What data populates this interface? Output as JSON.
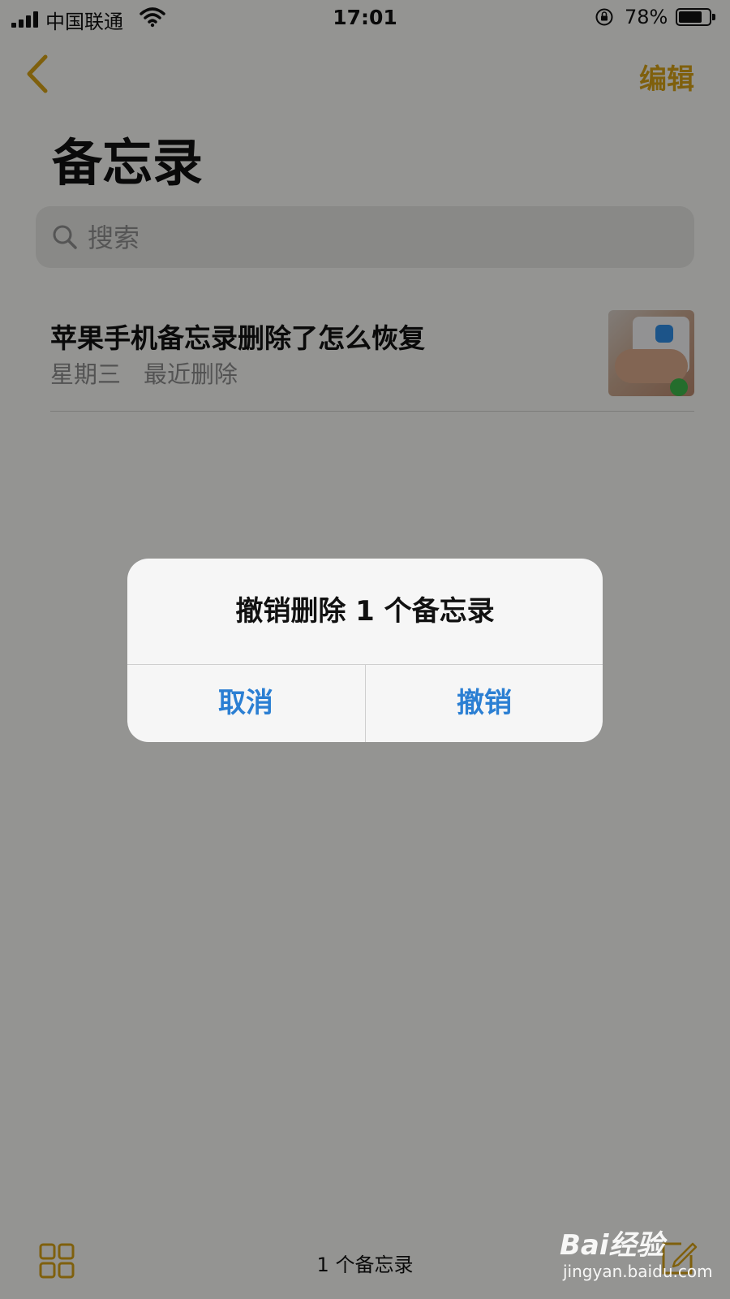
{
  "status_bar": {
    "carrier": "中国联通",
    "time": "17:01",
    "battery_percent_label": "78%",
    "battery_level": 0.78
  },
  "nav": {
    "edit_label": "编辑",
    "title": "备忘录"
  },
  "search": {
    "placeholder": "搜索"
  },
  "notes": [
    {
      "title": "苹果手机备忘录删除了怎么恢复",
      "day": "星期三",
      "folder": "最近删除"
    }
  ],
  "alert": {
    "title": "撤销删除 1 个备忘录",
    "cancel_label": "取消",
    "confirm_label": "撤销"
  },
  "toolbar": {
    "count_label": "1 个备忘录"
  },
  "watermark": {
    "logo": "Bai经验",
    "url": "jingyan.baidu.com"
  },
  "colors": {
    "accent": "#d4a017",
    "alert_button": "#2b7fd3",
    "background": "#f7f7f4"
  }
}
